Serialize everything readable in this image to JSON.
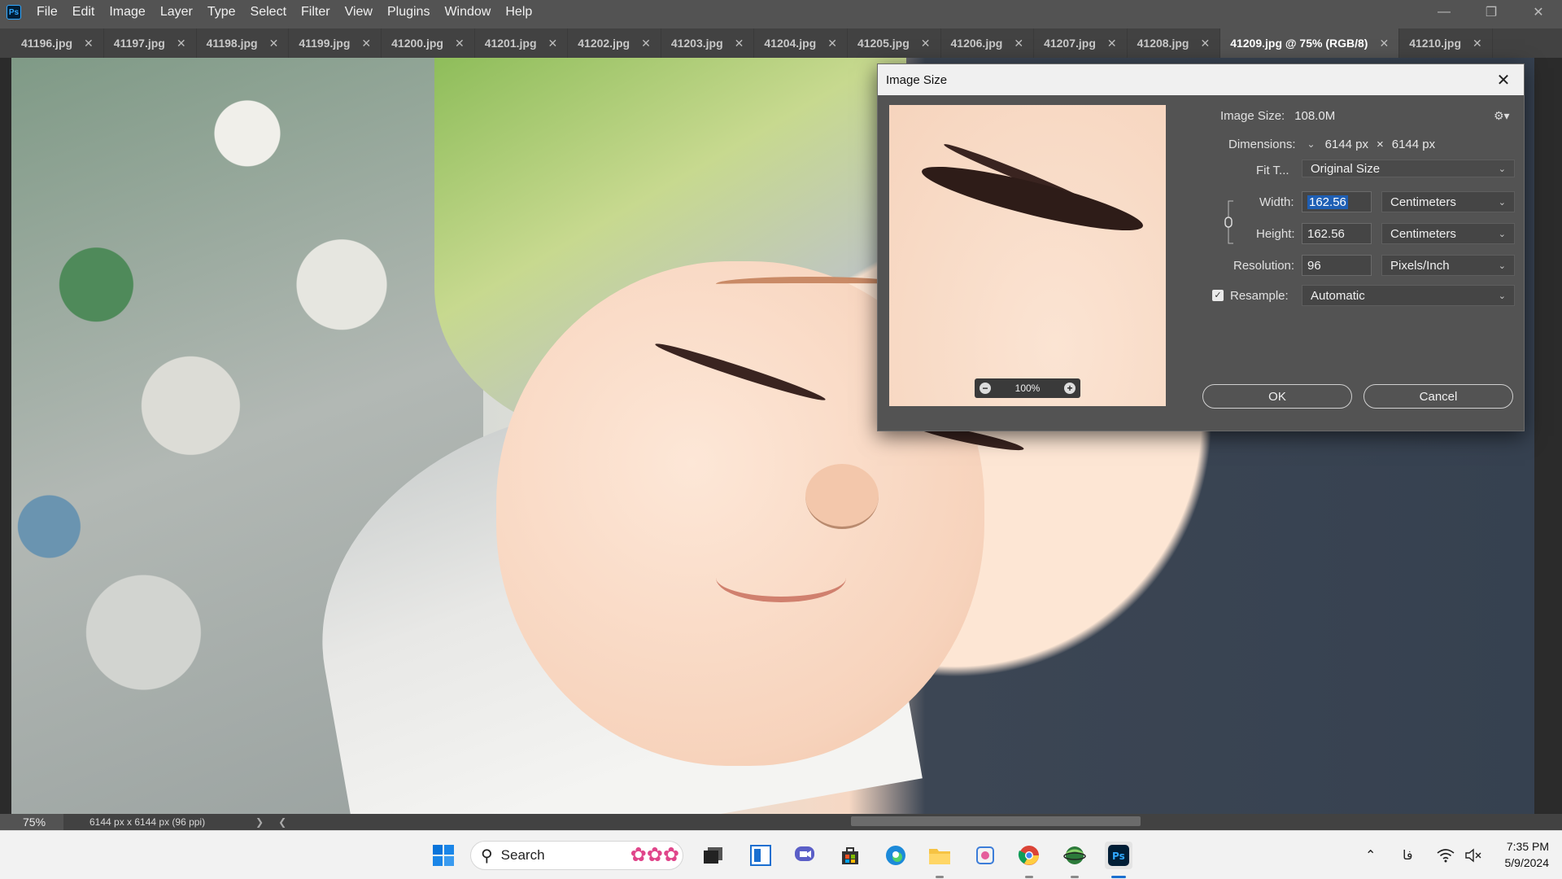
{
  "app": {
    "logo": "Ps",
    "menu": [
      "File",
      "Edit",
      "Image",
      "Layer",
      "Type",
      "Select",
      "Filter",
      "View",
      "Plugins",
      "Window",
      "Help"
    ]
  },
  "tabs": [
    {
      "label": "41196.jpg",
      "active": false
    },
    {
      "label": "41197.jpg",
      "active": false
    },
    {
      "label": "41198.jpg",
      "active": false
    },
    {
      "label": "41199.jpg",
      "active": false
    },
    {
      "label": "41200.jpg",
      "active": false
    },
    {
      "label": "41201.jpg",
      "active": false
    },
    {
      "label": "41202.jpg",
      "active": false
    },
    {
      "label": "41203.jpg",
      "active": false
    },
    {
      "label": "41204.jpg",
      "active": false
    },
    {
      "label": "41205.jpg",
      "active": false
    },
    {
      "label": "41206.jpg",
      "active": false
    },
    {
      "label": "41207.jpg",
      "active": false
    },
    {
      "label": "41208.jpg",
      "active": false
    },
    {
      "label": "41209.jpg @ 75% (RGB/8)",
      "active": true
    },
    {
      "label": "41210.jpg",
      "active": false
    }
  ],
  "dialog": {
    "title": "Image Size",
    "image_size_label": "Image Size:",
    "image_size_value": "108.0M",
    "dimensions_label": "Dimensions:",
    "dim_width": "6144 px",
    "dim_sep": "×",
    "dim_height": "6144 px",
    "fit_label": "Fit T...",
    "fit_value": "Original Size",
    "width_label": "Width:",
    "width_value": "162.56",
    "width_unit": "Centimeters",
    "height_label": "Height:",
    "height_value": "162.56",
    "height_unit": "Centimeters",
    "resolution_label": "Resolution:",
    "resolution_value": "96",
    "resolution_unit": "Pixels/Inch",
    "resample_label": "Resample:",
    "resample_checked": true,
    "resample_value": "Automatic",
    "preview_zoom": "100%",
    "ok_label": "OK",
    "cancel_label": "Cancel"
  },
  "status": {
    "zoom": "75%",
    "doc_info": "6144 px x 6144 px (96 ppi)"
  },
  "taskbar": {
    "search_label": "Search",
    "tray_lang": "فا",
    "time": "7:35 PM",
    "date": "5/9/2024"
  },
  "colors": {
    "ps_blue": "#31a8ff",
    "selection_blue": "#1f5fb4",
    "panel_gray": "#535353"
  }
}
